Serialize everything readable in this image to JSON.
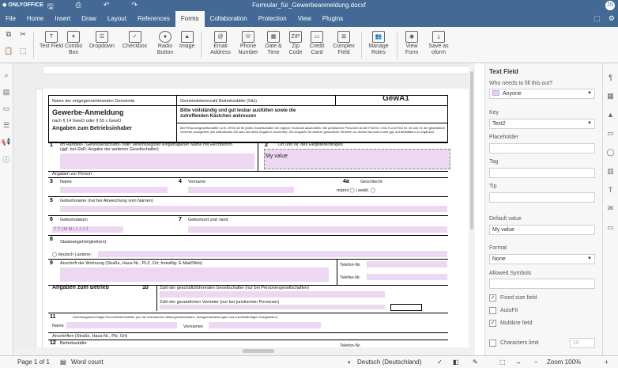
{
  "titlebar": {
    "app": "ONLYOFFICE",
    "doc_title": "Formular_für_Gewerbeanmeldung.docxf",
    "avatar": "JS"
  },
  "menu": {
    "tabs": [
      "File",
      "Home",
      "Insert",
      "Draw",
      "Layout",
      "References",
      "Forms",
      "Collaboration",
      "Protection",
      "View",
      "Plugins"
    ],
    "active": "Forms"
  },
  "toolbar": {
    "text_field": "Text Field",
    "combo_box": "Combo Box",
    "dropdown": "Dropdown",
    "checkbox": "Checkbox",
    "radio_button": "Radio Button",
    "image": "Image",
    "email": "Email Address",
    "phone": "Phone Number",
    "datetime": "Date & Time",
    "zip": "Zip Code",
    "credit": "Credit Card",
    "complex": "Complex Field",
    "manage_roles": "Manage Roles",
    "view_form": "View Form",
    "save_as": "Save as oform"
  },
  "panel": {
    "title": "Text Field",
    "who_label": "Who needs to fill this out?",
    "who_value": "Anyone",
    "key_label": "Key",
    "key_value": "Text2",
    "placeholder_label": "Placeholder",
    "tag_label": "Tag",
    "tip_label": "Tip",
    "default_label": "Default value",
    "default_value": "My value",
    "format_label": "Format",
    "format_value": "None",
    "allowed_label": "Allowed Symbols",
    "fixed_size": "Fixed size field",
    "autofit": "AutoFit",
    "multiline": "Multiline field",
    "char_limit": "Characters limit",
    "char_limit_value": "10"
  },
  "doc": {
    "gemeinde_label": "Name der entgegennehmenden Gemeinde",
    "kennzahl_label": "Gemeindekennzahl Betriebsstätte (Sitz)",
    "gewa": "GewA1",
    "title": "Gewerbe-Anmeldung",
    "subtitle": "nach § 14 GewO oder § 55 c GewO",
    "angaben_betriebsinhaber": "Angaben zum Betriebsinhaber",
    "instruction": "Bitte vollständig und gut lesbar ausfüllen sowie die zutreffenden Kästchen ankreuzen",
    "note": "Bei Personengesellschaften (z.B. OHG) ist für jeden Gesellschafter ein eigener Vordruck auszufüllen. Bei juristischen Personen ist bei Feld Nr. 3 bis 9 und Feld Nr. 30 und 31 der gesetzliche Vertreter anzugeben (bei inländischer AG wird auf diese Angaben verzichtet). Die Angaben für weitere gesetzliche Vertreter zu diesen Nummern sind ggf. auf Beiblättern zu ergänzen.",
    "f1": "Im Handels-, Genossenschafts- oder Vereinsregister eingetragener Name mit Rechtsform (ggf. bei GbR: Angabe der weiteren Gesellschafter)",
    "f2": "Ort und Nr. des Registereintrages",
    "my_value": "My value",
    "angaben_person": "Angaben zur Person",
    "f3": "Name",
    "f4": "Vorname",
    "f4a": "Geschlecht",
    "geschlecht_opts": "männl ◯ | weibl. ◯",
    "f5": "Geburtsname (nur bei Abweichung vom Namen)",
    "f6": "Geburtsdatum",
    "date_mask": "T T | M M | J J J J",
    "f7": "Geburtsort und -land",
    "f8": "Staatsangehörigkeit(en)",
    "deutsch": "◯ deutsch | andere:",
    "f9": "Anschrift der Wohnung (Straße, Haus-Nr., PLZ, Ort; freiwillig: E-Mail/Web)",
    "telefon": "Telefon-Nr.",
    "telefax": "Telefax-Nr.",
    "angaben_betrieb": "Angaben zum Betrieb",
    "f10a": "Zahl der geschäftsführenden Gesellschafter (nur bei Personengesellschaften)",
    "f10b": "Zahl der gesetzlichen Vertreter (nur bei juristischen Personen)",
    "f11": "Vertretungsberechtigte Person/Betriebsleiter (nur bei inländischen Aktiengesellschaften, Zweigniederlassungen und unselbständigen Zweigstellen)",
    "name": "Name",
    "vornamen": "Vornamen",
    "anschriften": "Anschriften (Straße, Haus-Nr., Plz, Ort)",
    "f12": "Betriebsstätte",
    "telefon2": "Telefon-Nr.",
    "n1": "1",
    "n2": "2",
    "n3": "3",
    "n4": "4",
    "n4a": "4a",
    "n5": "5",
    "n6": "6",
    "n7": "7",
    "n8": "8",
    "n9": "9",
    "n10": "10",
    "n11": "11",
    "n12": "12"
  },
  "status": {
    "page": "Page 1 of 1",
    "word_count": "Word count",
    "language": "Deutsch (Deutschland)",
    "zoom": "Zoom 100%"
  }
}
